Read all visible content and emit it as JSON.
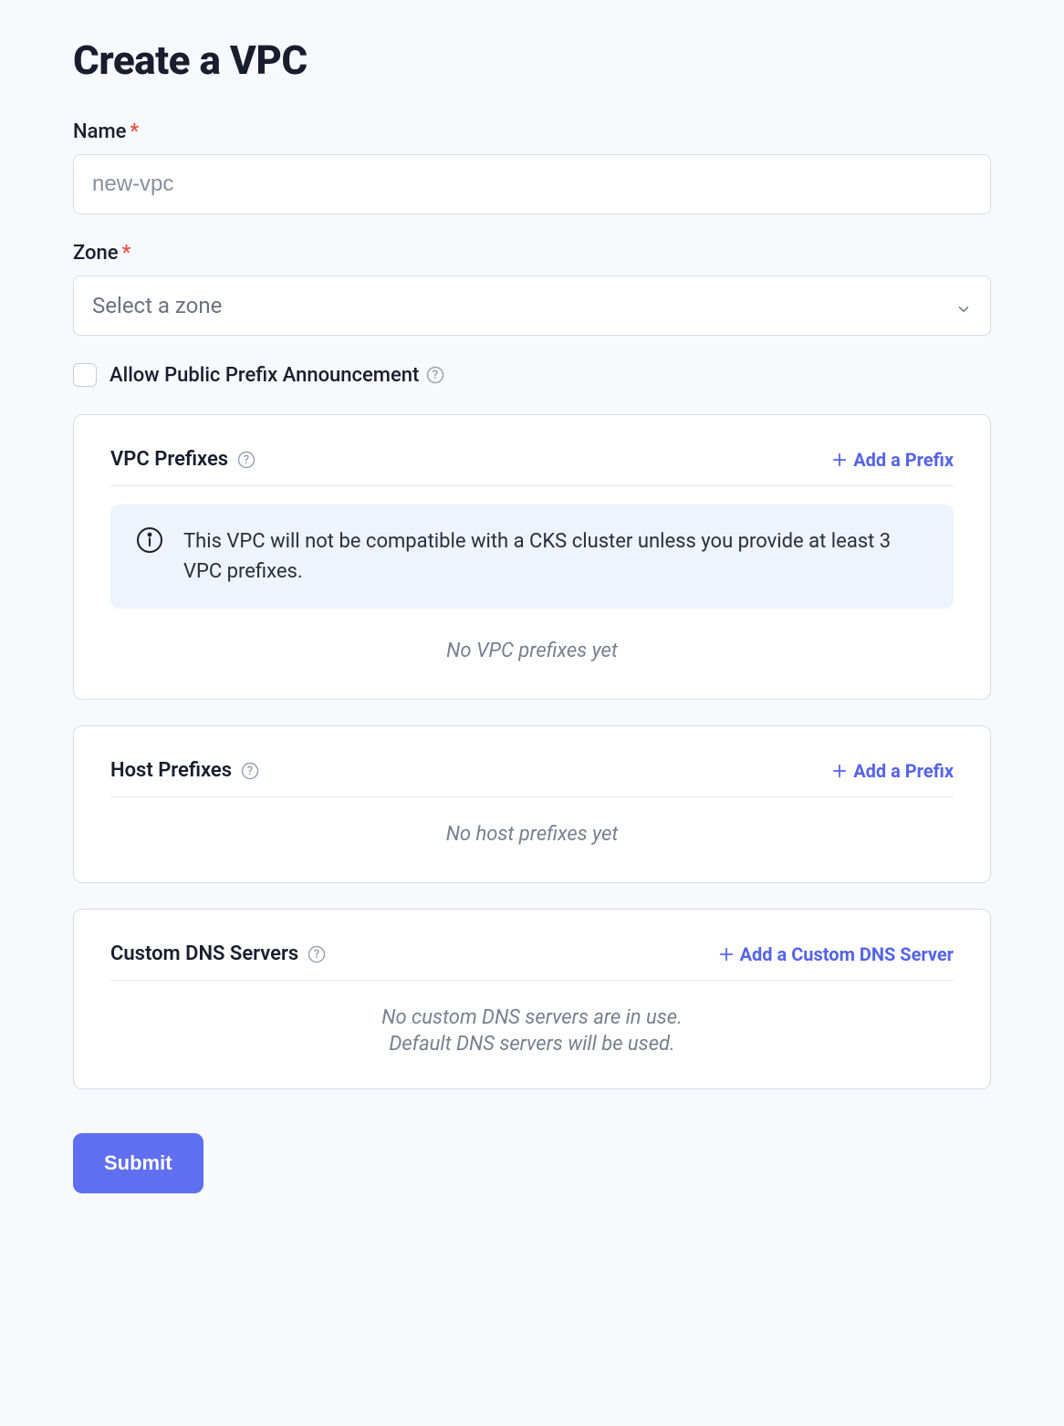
{
  "page": {
    "title": "Create a VPC"
  },
  "form": {
    "name_label": "Name",
    "name_placeholder": "new-vpc",
    "zone_label": "Zone",
    "zone_placeholder": "Select a zone",
    "allow_public_label": "Allow Public Prefix Announcement"
  },
  "vpc_prefixes": {
    "title": "VPC Prefixes",
    "add_label": "Add a Prefix",
    "info_text": "This VPC will not be compatible with a CKS cluster unless you provide at least 3 VPC prefixes.",
    "empty": "No VPC prefixes yet"
  },
  "host_prefixes": {
    "title": "Host Prefixes",
    "add_label": "Add a Prefix",
    "empty": "No host prefixes yet"
  },
  "dns": {
    "title": "Custom DNS Servers",
    "add_label": "Add a Custom DNS Server",
    "empty_line1": "No custom DNS servers are in use.",
    "empty_line2": "Default DNS servers will be used."
  },
  "actions": {
    "submit": "Submit"
  }
}
